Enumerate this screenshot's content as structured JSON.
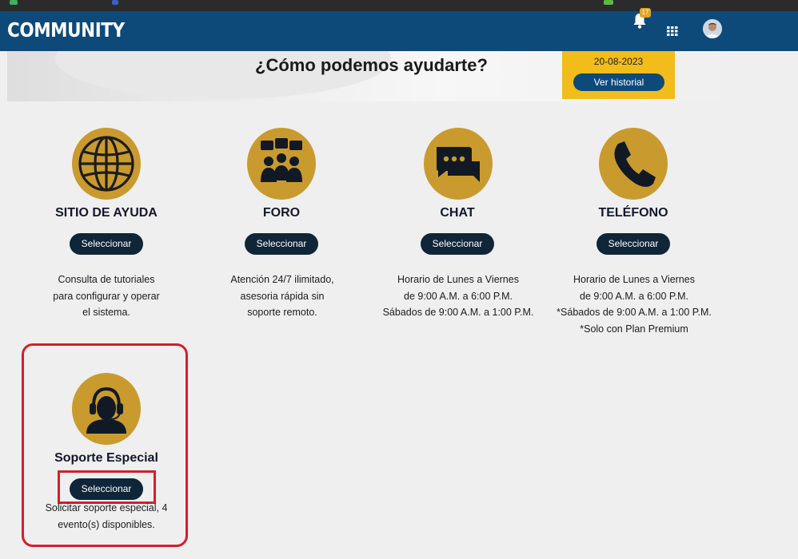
{
  "header": {
    "brand": "COMMUNITY",
    "notifications_count": "17",
    "icons": [
      "bell-icon",
      "apps-grid-icon",
      "user-avatar"
    ]
  },
  "hero": {
    "title": "¿Cómo podemos ayudarte?",
    "history_date": "20-08-2023",
    "history_button": "Ver historial"
  },
  "cards": [
    {
      "title": "SITIO DE AYUDA",
      "button": "Seleccionar",
      "icon": "globe-icon",
      "desc": [
        "Consulta de tutoriales",
        "para configurar y operar",
        "el sistema."
      ]
    },
    {
      "title": "FORO",
      "button": "Seleccionar",
      "icon": "forum-icon",
      "desc": [
        "Atención 24/7 ilimitado,",
        "asesoria rápida sin",
        "soporte remoto."
      ]
    },
    {
      "title": "CHAT",
      "button": "Seleccionar",
      "icon": "chat-icon",
      "desc": [
        "Horario de Lunes a Viernes",
        "de 9:00 A.M. a 6:00 P.M.",
        "Sábados de 9:00 A.M. a 1:00 P.M."
      ]
    },
    {
      "title": "TELÉFONO",
      "button": "Seleccionar",
      "icon": "phone-icon",
      "desc": [
        "Horario de Lunes a Viernes",
        "de 9:00 A.M. a 6:00 P.M.",
        "*Sábados de 9:00 A.M. a 1:00 P.M.",
        "*Solo con Plan Premium"
      ]
    },
    {
      "title": "Soporte Especial",
      "button": "Seleccionar",
      "icon": "headset-icon",
      "desc": [
        "Solicitar soporte especial, 4",
        "evento(s) disponibles."
      ]
    }
  ],
  "colors": {
    "header": "#0d4a7a",
    "accent_gold": "#c99a2e",
    "history_yellow": "#f2bd1a",
    "button_dark": "#0f2639",
    "highlight_red": "#d2202a",
    "background": "#efeff0"
  }
}
